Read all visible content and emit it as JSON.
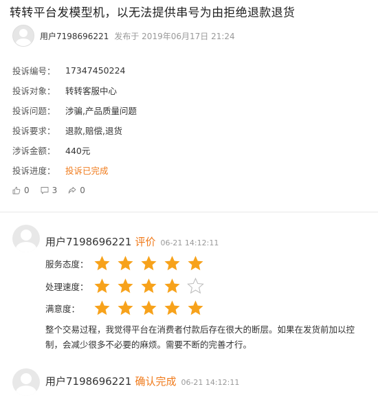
{
  "title": "转转平台发模型机，以无法提供串号为由拒绝退款退货",
  "author": {
    "name": "用户7198696221",
    "publish": "发布于 2019年06月17日 21:24"
  },
  "complaint": [
    {
      "label": "投诉编号：",
      "value": "17347450224"
    },
    {
      "label": "投诉对象：",
      "value": "转转客服中心"
    },
    {
      "label": "投诉问题：",
      "value": "涉骗,产品质量问题"
    },
    {
      "label": "投诉要求：",
      "value": "退款,赔偿,退货"
    },
    {
      "label": "涉诉金额：",
      "value": "440元"
    },
    {
      "label": "投诉进度：",
      "value": "投诉已完成",
      "status": true
    }
  ],
  "stats": {
    "likes": "0",
    "comments": "3",
    "shares": "0"
  },
  "review": {
    "user": "用户7198696221",
    "action": "评价",
    "time": "06-21 14:12:11",
    "ratings": [
      {
        "label": "服务态度：",
        "stars": 5
      },
      {
        "label": "处理速度：",
        "stars": 4
      },
      {
        "label": "满意度：",
        "stars": 5
      }
    ],
    "text": "整个交易过程，我觉得平台在消费者付款后存在很大的断层。如果在发货前加以控制，会减少很多不必要的麻烦。需要不断的完善才行。"
  },
  "confirm": {
    "user": "用户7198696221",
    "action": "确认完成",
    "time": "06-21 14:12:11"
  },
  "colors": {
    "accent": "#f07a1a",
    "star": "#f7a21b",
    "star_empty": "#bbbbbb"
  },
  "icons": {
    "like": "thumbs-up-icon",
    "comment": "comment-icon",
    "share": "share-icon",
    "star": "star-icon"
  }
}
